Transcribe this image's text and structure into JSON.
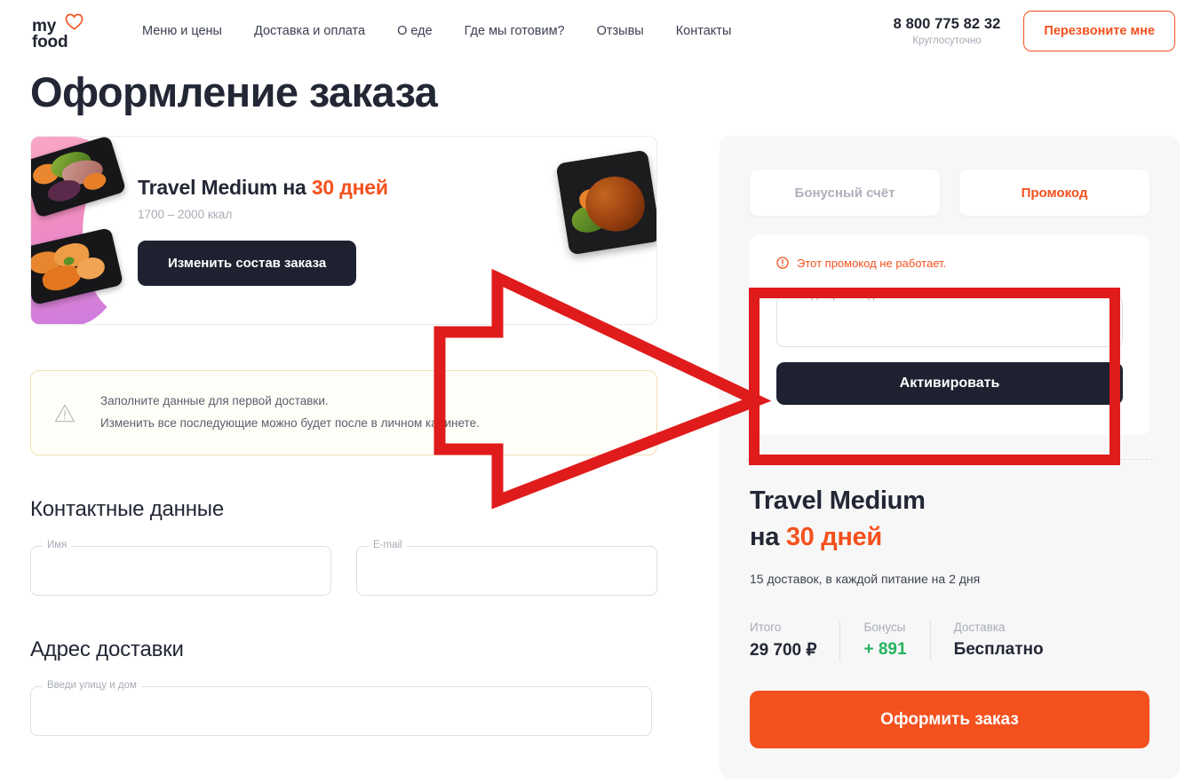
{
  "header": {
    "logo": {
      "line1": "my",
      "line2": "food",
      "icon": "heart-icon"
    },
    "nav": [
      {
        "label": "Меню и цены"
      },
      {
        "label": "Доставка и оплата"
      },
      {
        "label": "О еде"
      },
      {
        "label": "Где мы готовим?"
      },
      {
        "label": "Отзывы"
      },
      {
        "label": "Контакты"
      }
    ],
    "phone": "8 800 775 82 32",
    "phone_note": "Круглосуточно",
    "callback_label": "Перезвоните мне"
  },
  "page": {
    "title": "Оформление заказа"
  },
  "plan_card": {
    "title_main": "Travel Medium на ",
    "title_accent": "30 дней",
    "calories": "1700 – 2000 ккал",
    "edit_button": "Изменить состав заказа"
  },
  "notice": {
    "icon": "warning-triangle-icon",
    "line1": "Заполните данные для первой доставки.",
    "line2": "Изменить все последующие можно будет после в личном кабинете."
  },
  "contacts": {
    "section_title": "Контактные данные",
    "name_label": "Имя",
    "name_value": "",
    "email_label": "E-mail",
    "email_value": ""
  },
  "address": {
    "section_title": "Адрес доставки",
    "street_label": "Введи улицу и дом",
    "street_value": ""
  },
  "sidebar": {
    "tabs": [
      {
        "label": "Бонусный счёт",
        "state": "inactive"
      },
      {
        "label": "Промокод",
        "state": "active"
      }
    ],
    "promo": {
      "error_icon": "error-circle-icon",
      "error_text": "Этот промокод не работает.",
      "input_label": "Введи промокод",
      "input_value": "",
      "activate_label": "Активировать"
    },
    "summary": {
      "title_line1": "Travel Medium",
      "title_line2_prefix": "на ",
      "title_line2_accent": "30 дней",
      "subtitle": "15 доставок, в каждой питание на 2 дня",
      "totals": [
        {
          "label": "Итого",
          "value": "29 700 ₽",
          "color": "#232735"
        },
        {
          "label": "Бонусы",
          "value": "+ 891",
          "color": "#24b35e"
        },
        {
          "label": "Доставка",
          "value": "Бесплатно",
          "color": "#232735"
        }
      ],
      "checkout_label": "Оформить заказ"
    }
  },
  "annotations": {
    "color": "#e01b1b",
    "arrow": {
      "name": "red-arrow-pointing-right"
    },
    "highlight_box": {
      "name": "red-highlight-rectangle"
    }
  },
  "colors": {
    "brand_orange": "#f4511e",
    "dark": "#1e2230",
    "green": "#24b35e",
    "annotation_red": "#e01b1b"
  }
}
